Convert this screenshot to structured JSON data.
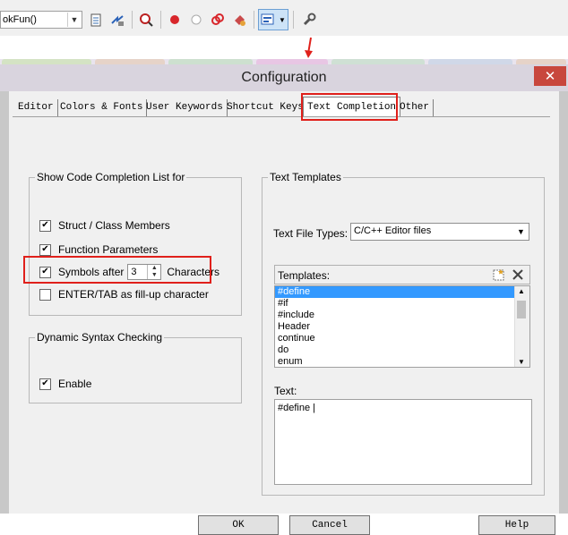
{
  "toolbar": {
    "function_combo": "okFun()",
    "icons": [
      "file-icon",
      "jump-icon",
      "find-in-files-icon",
      "record-icon",
      "stop-icon",
      "chain-icon",
      "clear-icon",
      "configure-view-icon",
      "wrench-icon"
    ]
  },
  "dialog": {
    "title": "Configuration",
    "close": "✕",
    "tabs": [
      "Editor",
      "Colors & Fonts",
      "User Keywords",
      "Shortcut Keys",
      "Text Completion",
      "Other"
    ],
    "active_tab": "Text Completion"
  },
  "completion": {
    "group_label": "Show Code Completion List for",
    "struct_members": "Struct / Class Members",
    "function_params": "Function Parameters",
    "symbols_after": "Symbols after",
    "symbols_count": "3",
    "characters": "Characters",
    "enter_tab": "ENTER/TAB as fill-up character",
    "checked": [
      true,
      true,
      true,
      false
    ]
  },
  "syntax": {
    "group_label": "Dynamic Syntax Checking",
    "enable": "Enable",
    "enable_checked": true
  },
  "templates": {
    "group_label": "Text Templates",
    "file_types_label": "Text File Types:",
    "file_types_value": "C/C++ Editor files",
    "templates_label": "Templates:",
    "items": [
      "#define",
      "#if",
      "#include",
      "Header",
      "continue",
      "do",
      "enum"
    ],
    "selected": "#define",
    "text_label": "Text:",
    "text_value": "#define |"
  },
  "buttons": {
    "ok": "OK",
    "cancel": "Cancel",
    "help": "Help"
  },
  "colors": {
    "highlight": "#e0201b",
    "selection": "#3399ff"
  }
}
